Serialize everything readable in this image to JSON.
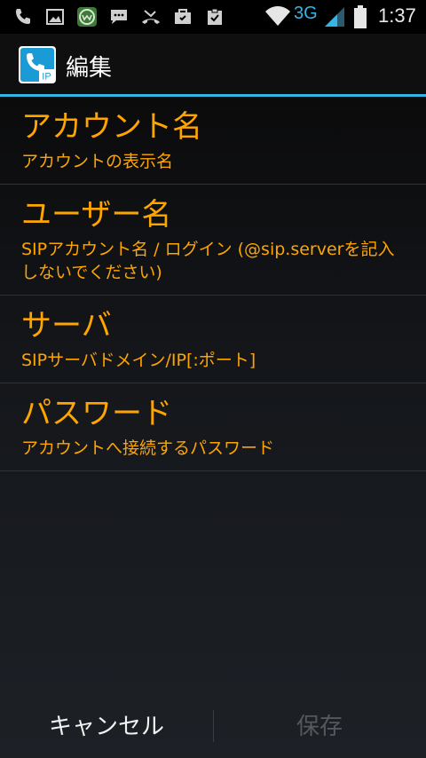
{
  "status_bar": {
    "network": "3G",
    "time": "1:37",
    "icons": [
      "phone-icon",
      "image-icon",
      "ww-app-icon",
      "chat-icon",
      "missed-call-icon",
      "briefcase-icon",
      "clipboard-check-icon",
      "wifi-icon",
      "signal-icon",
      "battery-icon"
    ]
  },
  "action_bar": {
    "title": "編集",
    "app_icon_text": "IP"
  },
  "preferences": [
    {
      "title": "アカウント名",
      "summary": "アカウントの表示名"
    },
    {
      "title": "ユーザー名",
      "summary": "SIPアカウント名 / ログイン (@sip.serverを記入しないでください)"
    },
    {
      "title": "サーバ",
      "summary": "SIPサーバドメイン/IP[:ポート]"
    },
    {
      "title": "パスワード",
      "summary": "アカウントへ接続するパスワード"
    }
  ],
  "buttons": {
    "cancel": "キャンセル",
    "save": "保存"
  },
  "colors": {
    "accent": "#33b5e5",
    "pref_text": "#ffa500",
    "disabled_text": "#55585d"
  }
}
